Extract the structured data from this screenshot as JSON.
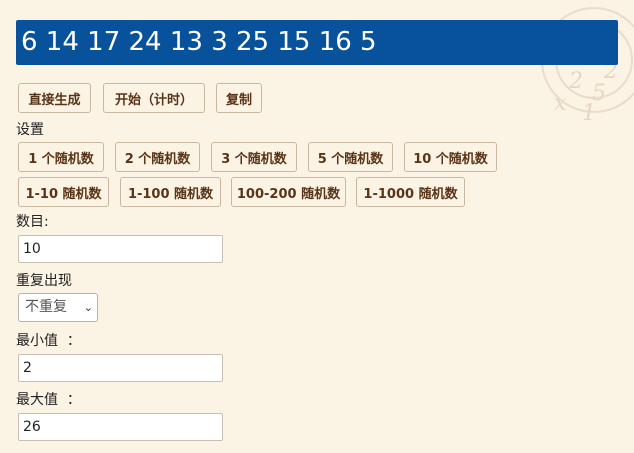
{
  "result": {
    "numbers": "6 14 17 24 13 3 25 15 16 5"
  },
  "actions": {
    "generate": "直接生成",
    "start": "开始（计时）",
    "copy": "复制"
  },
  "settings": {
    "heading": "设置",
    "presets_count": [
      "1 个随机数",
      "2 个随机数",
      "3 个随机数",
      "5 个随机数",
      "10 个随机数"
    ],
    "presets_range": [
      "1-10 随机数",
      "1-100 随机数",
      "100-200 随机数",
      "1-1000 随机数"
    ]
  },
  "fields": {
    "count_label": "数目:",
    "count_value": "10",
    "repeat_label": "重复出现",
    "repeat_value": "不重复",
    "min_label": "最小值  ：",
    "min_value": "2",
    "max_label": "最大值  ：",
    "max_value": "26"
  },
  "colors": {
    "result_bg": "#07529b",
    "page_bg": "#fbf3e4",
    "button_text": "#5a3418"
  }
}
